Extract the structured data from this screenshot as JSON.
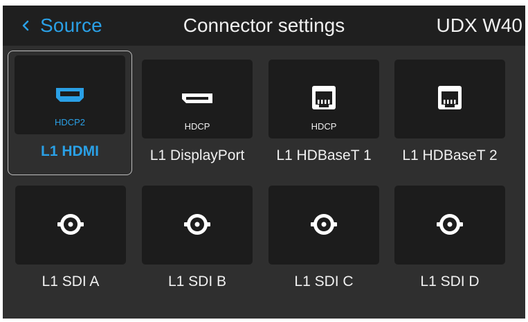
{
  "header": {
    "back_label": "Source",
    "title": "Connector settings",
    "device": "UDX W40"
  },
  "colors": {
    "accent": "#2aa0e6",
    "background": "#2f2f2f",
    "header": "#1f1f1f",
    "tile": "#1c1c1c",
    "text": "#f0f0f0"
  },
  "connectors": [
    {
      "label": "L1 HDMI",
      "badge": "HDCP2",
      "icon": "hdmi-icon",
      "selected": true
    },
    {
      "label": "L1 DisplayPort",
      "badge": "HDCP",
      "icon": "displayport-icon",
      "selected": false
    },
    {
      "label": "L1 HDBaseT 1",
      "badge": "HDCP",
      "icon": "hdbaset-icon",
      "selected": false
    },
    {
      "label": "L1 HDBaseT 2",
      "badge": "",
      "icon": "hdbaset-icon",
      "selected": false
    },
    {
      "label": "L1 SDI A",
      "badge": "",
      "icon": "sdi-icon",
      "selected": false
    },
    {
      "label": "L1 SDI B",
      "badge": "",
      "icon": "sdi-icon",
      "selected": false
    },
    {
      "label": "L1 SDI C",
      "badge": "",
      "icon": "sdi-icon",
      "selected": false
    },
    {
      "label": "L1 SDI D",
      "badge": "",
      "icon": "sdi-icon",
      "selected": false
    }
  ]
}
